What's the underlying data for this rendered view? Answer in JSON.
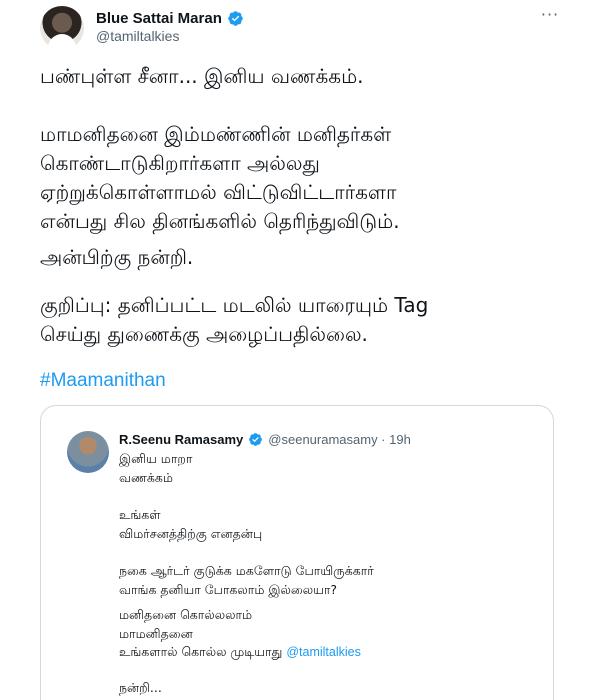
{
  "tweet": {
    "author_name": "Blue Sattai Maran",
    "author_handle": "@tamiltalkies",
    "more_icon": "more-horizontal-icon",
    "verified_color": "#1d9bf0",
    "paragraph1": "பண்புள்ள சீனா... இனிய வணக்கம்.",
    "paragraph2_lines": [
      "மாமனிதனை இம்மண்ணின் மனிதர்கள்",
      "கொண்டாடுகிறார்களா அல்லது",
      "ஏற்றுக்கொள்ளாமல் விட்டுவிட்டார்களா",
      "என்பது சில தினங்களில் தெரிந்துவிடும்."
    ],
    "paragraph3": "அன்பிற்கு நன்றி.",
    "paragraph4_lines": [
      "குறிப்பு: தனிப்பட்ட மடலில் யாரையும் Tag",
      "செய்து துணைக்கு அழைப்பதில்லை."
    ],
    "hashtag": "#Maamanithan"
  },
  "quoted": {
    "author_name": "R.Seenu Ramasamy",
    "author_handle": "@seenuramasamy · 19h",
    "lines": [
      "இனிய மாறா",
      "வணக்கம்",
      "உங்கள்",
      "விமர்சனத்திற்கு எனதன்பு",
      "நகை ஆர்டர் குடுக்க மகளோடு போயிருக்கார்",
      "வாங்க தனியா போகலாம் இல்லையா?",
      "மனிதனை கொல்லலாம்",
      "மாமனிதனை"
    ],
    "last_line_text": "உங்களால் கொல்ல முடியாது",
    "mention": "@tamiltalkies",
    "closing": "நன்றி..."
  },
  "colors": {
    "link": "#1d9bf0",
    "secondary_text": "#536471",
    "border": "#cfd9de"
  }
}
